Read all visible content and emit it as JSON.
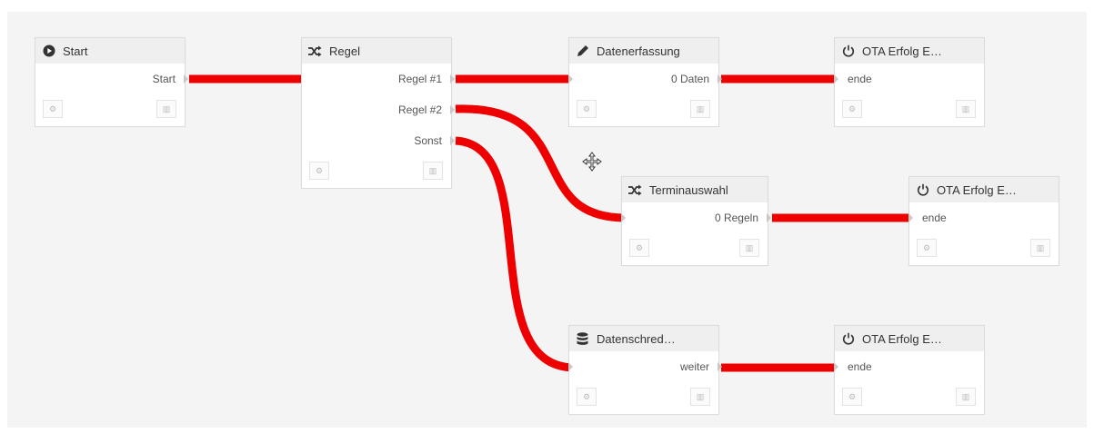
{
  "nodes": {
    "start": {
      "title": "Start",
      "outputs": [
        "Start"
      ]
    },
    "regel": {
      "title": "Regel",
      "outputs": [
        "Regel #1",
        "Regel #2",
        "Sonst"
      ]
    },
    "datenerfassung": {
      "title": "Datenerfassung",
      "outputs": [
        "0 Daten"
      ]
    },
    "terminauswahl": {
      "title": "Terminauswahl",
      "outputs": [
        "0 Regeln"
      ]
    },
    "datenschred": {
      "title": "Datenschred…",
      "outputs": [
        "weiter"
      ]
    },
    "ota1": {
      "title": "OTA Erfolg E…",
      "input": "ende"
    },
    "ota2": {
      "title": "OTA Erfolg E…",
      "input": "ende"
    },
    "ota3": {
      "title": "OTA Erfolg E…",
      "input": "ende"
    }
  },
  "connections": [
    {
      "from": "Start",
      "to": "Regel"
    },
    {
      "from": "Regel #1",
      "to": "Datenerfassung"
    },
    {
      "from": "Regel #2",
      "to": "Terminauswahl"
    },
    {
      "from": "Sonst",
      "to": "Datenschred…"
    },
    {
      "from": "0 Daten",
      "to": "OTA Erfolg E…"
    },
    {
      "from": "0 Regeln",
      "to": "OTA Erfolg E…"
    },
    {
      "from": "weiter",
      "to": "OTA Erfolg E…"
    }
  ],
  "colors": {
    "wire": "#ee0000",
    "node_header": "#efefef",
    "canvas": "#f4f4f4"
  },
  "icons": {
    "start": "play-circle-icon",
    "regel": "shuffle-icon",
    "datenerfassung": "pen-icon",
    "terminauswahl": "shuffle-icon",
    "datenschred": "database-icon",
    "ota": "power-icon",
    "node_settings": "gears-icon",
    "node_delete": "trash-icon",
    "canvas_move": "move-arrows-icon"
  }
}
